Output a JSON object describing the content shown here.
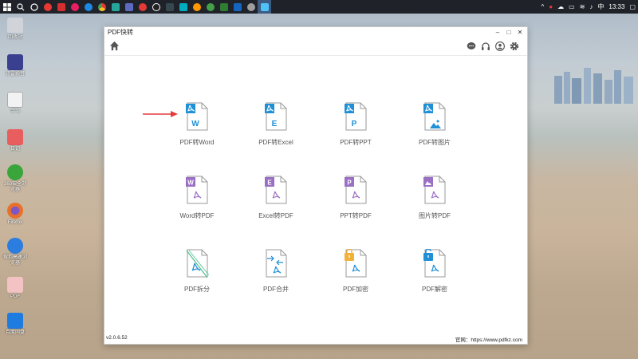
{
  "taskbar": {
    "time": "13:33",
    "lang": "中",
    "icons": [
      "windows-start",
      "search",
      "task-view",
      "app-red-1",
      "app-red-2",
      "app-red-3",
      "app-blue-1",
      "chrome",
      "app-green",
      "app-blue-2",
      "app-red-4",
      "penguin",
      "app-dark",
      "app-teal",
      "app-orange",
      "wechat",
      "app-green-2",
      "app-blue-3",
      "app-gray",
      "app-active"
    ]
  },
  "desktop": {
    "icons": [
      {
        "label": "回收站",
        "color": "#d0d4da"
      },
      {
        "label": "迅雷影音",
        "color": "#3a3f8f"
      },
      {
        "label": "学习",
        "color": "#f2f2f2"
      },
      {
        "label": "日记",
        "color": "#e85d5d"
      },
      {
        "label": "360安全浏览器",
        "color": "#3aa53a"
      },
      {
        "label": "Firefox",
        "color": "#e8702a"
      },
      {
        "label": "搜狗高速浏览器",
        "color": "#2b7de0"
      },
      {
        "label": "PDF",
        "color": "#e05555"
      },
      {
        "label": "百度网盘",
        "color": "#1e7be0"
      }
    ]
  },
  "app": {
    "title": "PDF快转",
    "version": "v2.0.6.52",
    "website": "官网：https://www.pdfkz.com",
    "tools": [
      {
        "label": "PDF转Word",
        "letter": "W",
        "style": "to"
      },
      {
        "label": "PDF转Excel",
        "letter": "E",
        "style": "to"
      },
      {
        "label": "PDF转PPT",
        "letter": "P",
        "style": "to"
      },
      {
        "label": "PDF转图片",
        "letter": "",
        "style": "to-image"
      },
      {
        "label": "Word转PDF",
        "letter": "W",
        "style": "from"
      },
      {
        "label": "Excel转PDF",
        "letter": "E",
        "style": "from"
      },
      {
        "label": "PPT转PDF",
        "letter": "P",
        "style": "from"
      },
      {
        "label": "图片转PDF",
        "letter": "",
        "style": "from-image"
      },
      {
        "label": "PDF拆分",
        "letter": "",
        "style": "split"
      },
      {
        "label": "PDF合并",
        "letter": "",
        "style": "merge"
      },
      {
        "label": "PDF加密",
        "letter": "",
        "style": "lock"
      },
      {
        "label": "PDF解密",
        "letter": "",
        "style": "unlock"
      }
    ]
  },
  "colors": {
    "blue": "#1f8fd6",
    "purple": "#9b6fc4",
    "orange": "#f2b23a",
    "arrow_red": "#e33c3c"
  }
}
